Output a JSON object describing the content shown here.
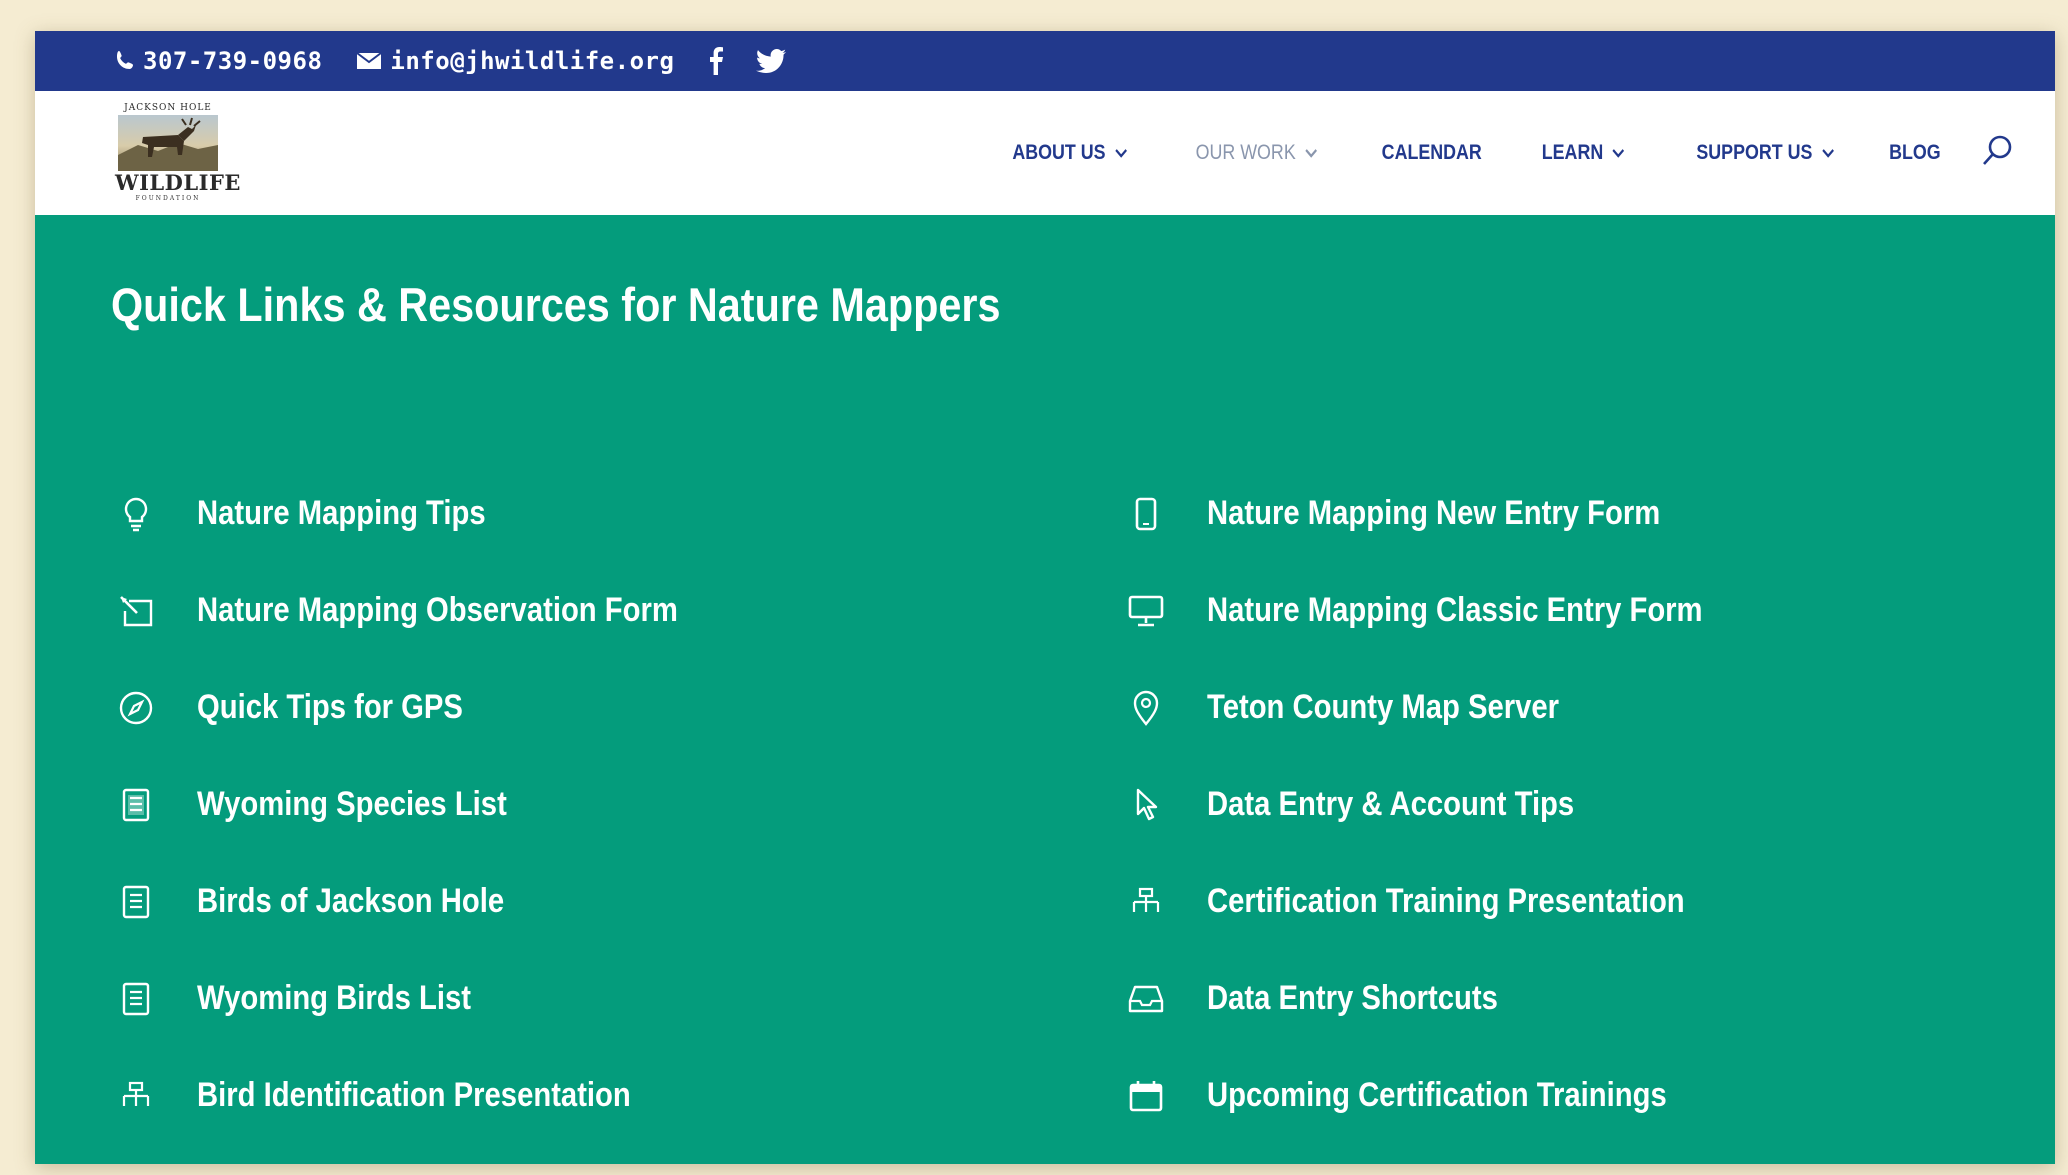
{
  "topbar": {
    "phone": "307-739-0968",
    "email": "info@jhwildlife.org",
    "icons": [
      "phone-icon",
      "mail-icon",
      "facebook-icon",
      "twitter-icon"
    ],
    "background": "#22398c"
  },
  "logo": {
    "top_text": "JACKSON HOLE",
    "word": "WILDLIFE",
    "sub": "FOUNDATION"
  },
  "nav": {
    "items": [
      {
        "label": "ABOUT US",
        "has_dropdown": true
      },
      {
        "label": "OUR WORK",
        "has_dropdown": true,
        "active": true
      },
      {
        "label": "CALENDAR",
        "has_dropdown": false
      },
      {
        "label": "LEARN",
        "has_dropdown": true
      },
      {
        "label": "SUPPORT US",
        "has_dropdown": true
      },
      {
        "label": "BLOG",
        "has_dropdown": false
      }
    ],
    "search_icon": "search-icon"
  },
  "hero": {
    "title": "Quick Links & Resources for Nature Mappers",
    "background": "#049c7c",
    "left_links": [
      {
        "label": "Nature Mapping Tips",
        "icon": "lightbulb-icon"
      },
      {
        "label": "Nature Mapping Observation Form",
        "icon": "edit-form-icon"
      },
      {
        "label": "Quick Tips for GPS",
        "icon": "compass-icon"
      },
      {
        "label": "Wyoming Species List",
        "icon": "document-icon"
      },
      {
        "label": "Birds of Jackson Hole",
        "icon": "document-icon"
      },
      {
        "label": "Wyoming Birds List",
        "icon": "document-icon"
      },
      {
        "label": "Bird Identification Presentation",
        "icon": "sitemap-icon"
      }
    ],
    "right_links": [
      {
        "label": "Nature Mapping New Entry Form",
        "icon": "mobile-icon"
      },
      {
        "label": "Nature Mapping Classic Entry Form",
        "icon": "desktop-icon"
      },
      {
        "label": "Teton County Map Server",
        "icon": "map-pin-icon"
      },
      {
        "label": "Data Entry & Account Tips",
        "icon": "cursor-icon"
      },
      {
        "label": "Certification Training Presentation",
        "icon": "sitemap-icon"
      },
      {
        "label": "Data Entry Shortcuts",
        "icon": "inbox-icon"
      },
      {
        "label": "Upcoming Certification Trainings",
        "icon": "calendar-icon"
      }
    ]
  }
}
